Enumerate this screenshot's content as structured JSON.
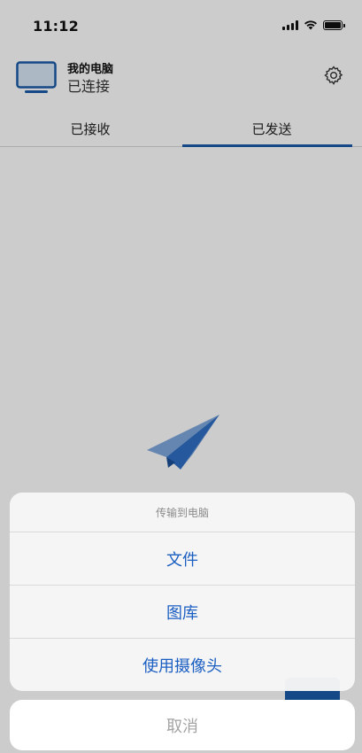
{
  "status_bar": {
    "time": "11:12",
    "icons": [
      "cellular-signal-icon",
      "wifi-icon",
      "battery-icon"
    ]
  },
  "header": {
    "device_icon": "monitor-icon",
    "device_name": "我的电脑",
    "device_status": "已连接",
    "settings_icon": "gear-icon"
  },
  "tabs": {
    "items": [
      {
        "label": "已接收",
        "active": false
      },
      {
        "label": "已发送",
        "active": true
      }
    ]
  },
  "empty_state": {
    "icon": "paper-plane-icon"
  },
  "action_sheet": {
    "title": "传输到电脑",
    "options": [
      {
        "label": "文件"
      },
      {
        "label": "图库"
      },
      {
        "label": "使用摄像头"
      }
    ],
    "cancel_label": "取消"
  },
  "colors": {
    "accent": "#1a5aa8",
    "action_text": "#1a5ec2",
    "cancel_text": "#a3a3a3",
    "overlay": "rgba(0,0,0,0.2)"
  }
}
